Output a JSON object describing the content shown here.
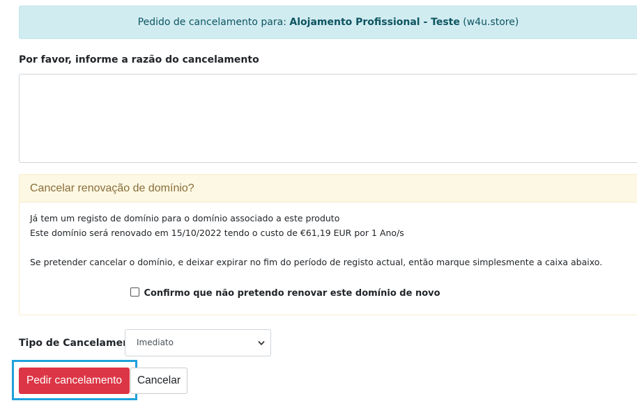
{
  "info_alert": {
    "prefix": "Pedido de cancelamento para:",
    "product": "Alojamento Profissional - Teste",
    "domain": "(w4u.store)"
  },
  "reason": {
    "label": "Por favor, informe a razão do cancelamento",
    "value": ""
  },
  "domain_card": {
    "title": "Cancelar renovação de domínio?",
    "line1": "Já tem um registo de domínio para o domínio associado a este produto",
    "line2": "Este domínio será renovado em 15/10/2022 tendo o custo de €61,19 EUR por 1 Ano/s",
    "line3": "Se pretender cancelar o domínio, e deixar expirar no fim do período de registo actual, então marque simplesmente a caixa abaixo.",
    "confirm_label": "Confirmo que não pretendo renovar este domínio de novo",
    "confirm_checked": false
  },
  "cancel_type": {
    "label": "Tipo de Cancelamento",
    "selected": "Imediato"
  },
  "buttons": {
    "submit_label": "Pedir cancelamento",
    "cancel_label": "Cancelar"
  },
  "colors": {
    "info_bg": "#d1ecf1",
    "warning_header_bg": "#fcf8e3",
    "danger": "#dc3545",
    "focus_outline": "#1ea1dc"
  }
}
